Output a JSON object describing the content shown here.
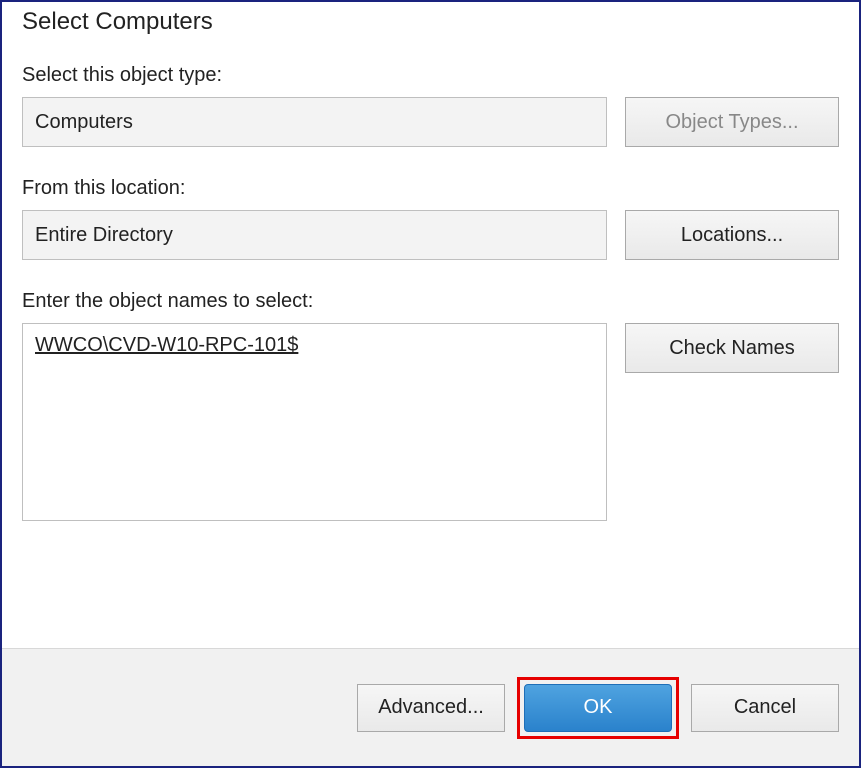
{
  "dialog": {
    "title": "Select Computers",
    "object_type_label": "Select this object type:",
    "object_type_value": "Computers",
    "object_types_button": "Object Types...",
    "location_label": "From this location:",
    "location_value": "Entire Directory",
    "locations_button": "Locations...",
    "names_label": "Enter the object names to select:",
    "names_value": "WWCO\\CVD-W10-RPC-101$",
    "check_names_button": "Check Names",
    "advanced_button": "Advanced...",
    "ok_button": "OK",
    "cancel_button": "Cancel"
  }
}
